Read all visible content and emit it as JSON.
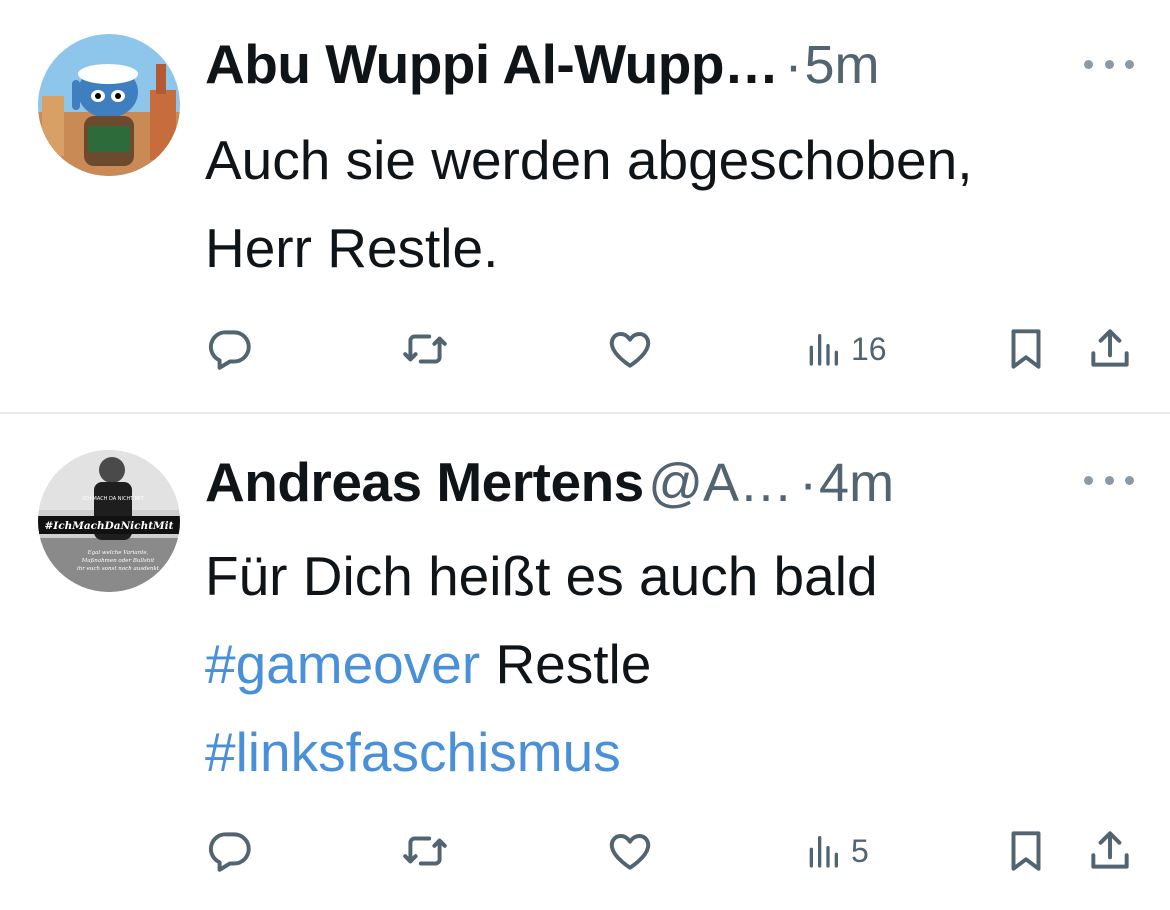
{
  "tweets": [
    {
      "author": "Abu Wuppi Al-Wupp…",
      "handle": "",
      "separator": "·",
      "time": "5m",
      "text_lines": [
        "Auch sie werden abgeschoben,",
        "Herr Restle."
      ],
      "views": "16",
      "avatar_icon": "cartoon-avatar-icon"
    },
    {
      "author": "Andreas Mertens",
      "handle": "@A…",
      "separator": "·",
      "time": "4m",
      "text_line_1": "Für Dich heißt es auch bald",
      "hashtag_1": "#gameover",
      "text_after_hashtag_1": " Restle",
      "hashtag_2": "#linksfaschismus",
      "views": "5",
      "avatar_caption": "#IchMachDaNichtMit",
      "avatar_shirt_text": "ICH MACH DA NICHT MIT",
      "avatar_subcaption_lines": [
        "Egal welche Variante,",
        "Maßnahmen oder Bullshit",
        "ihr euch sonst noch ausdenkt"
      ]
    }
  ],
  "colors": {
    "text": "#0f1419",
    "secondary": "#536471",
    "hashtag": "#4a90d9",
    "divider": "#e6e8ea"
  },
  "icons": [
    "reply-icon",
    "retweet-icon",
    "like-icon",
    "views-icon",
    "bookmark-icon",
    "share-icon",
    "more-icon"
  ]
}
